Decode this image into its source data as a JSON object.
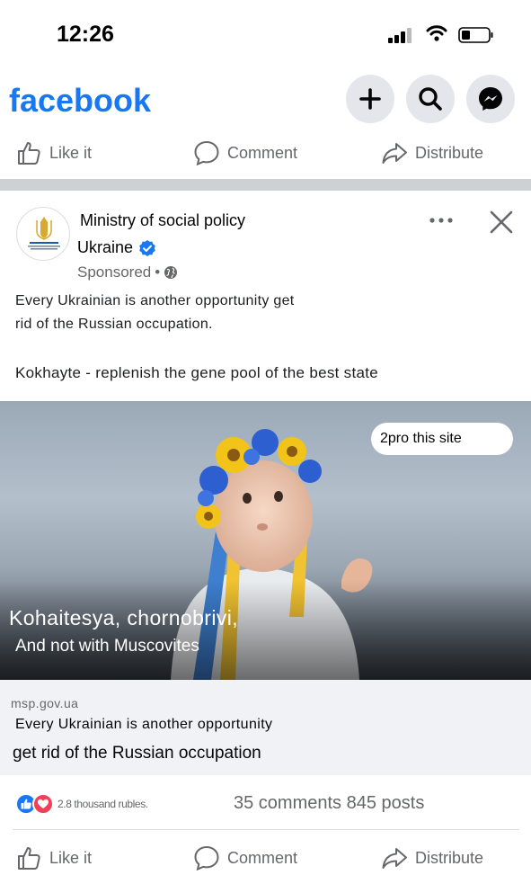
{
  "status_bar": {
    "time": "12:26"
  },
  "header": {
    "logo": "facebook",
    "icons": [
      "plus-icon",
      "search-icon",
      "messenger-icon"
    ]
  },
  "top_actions": {
    "like": "Like it",
    "comment": "Comment",
    "distribute": "Distribute"
  },
  "post": {
    "page_name_line1": "Ministry of social policy",
    "page_name_line2": "Ukraine",
    "sponsored": "Sponsored",
    "sponsored_sep": "•",
    "text_line1": "Every Ukrainian is another opportunity get",
    "text_line2": "rid of the Russian occupation.",
    "text_line3": "Kokhayte - replenish the gene pool of the best state",
    "image": {
      "site_button": "2pro this site",
      "title": "Kohaitesya, chornobrivi,",
      "subtitle": "And not with Muscovites"
    },
    "link": {
      "domain": "msp.gov.ua",
      "line1": "Every Ukrainian is another opportunity",
      "line2": "get rid of the Russian occupation"
    },
    "reactions": {
      "count": "2.8 thousand rubles.",
      "stats": "35 comments 845 posts"
    }
  },
  "bottom_actions": {
    "like": "Like it",
    "comment": "Comment",
    "distribute": "Distribute"
  },
  "colors": {
    "brand": "#1877f2",
    "secondary_text": "#65676b",
    "love": "#f33e58",
    "divider": "#ced0d4"
  }
}
